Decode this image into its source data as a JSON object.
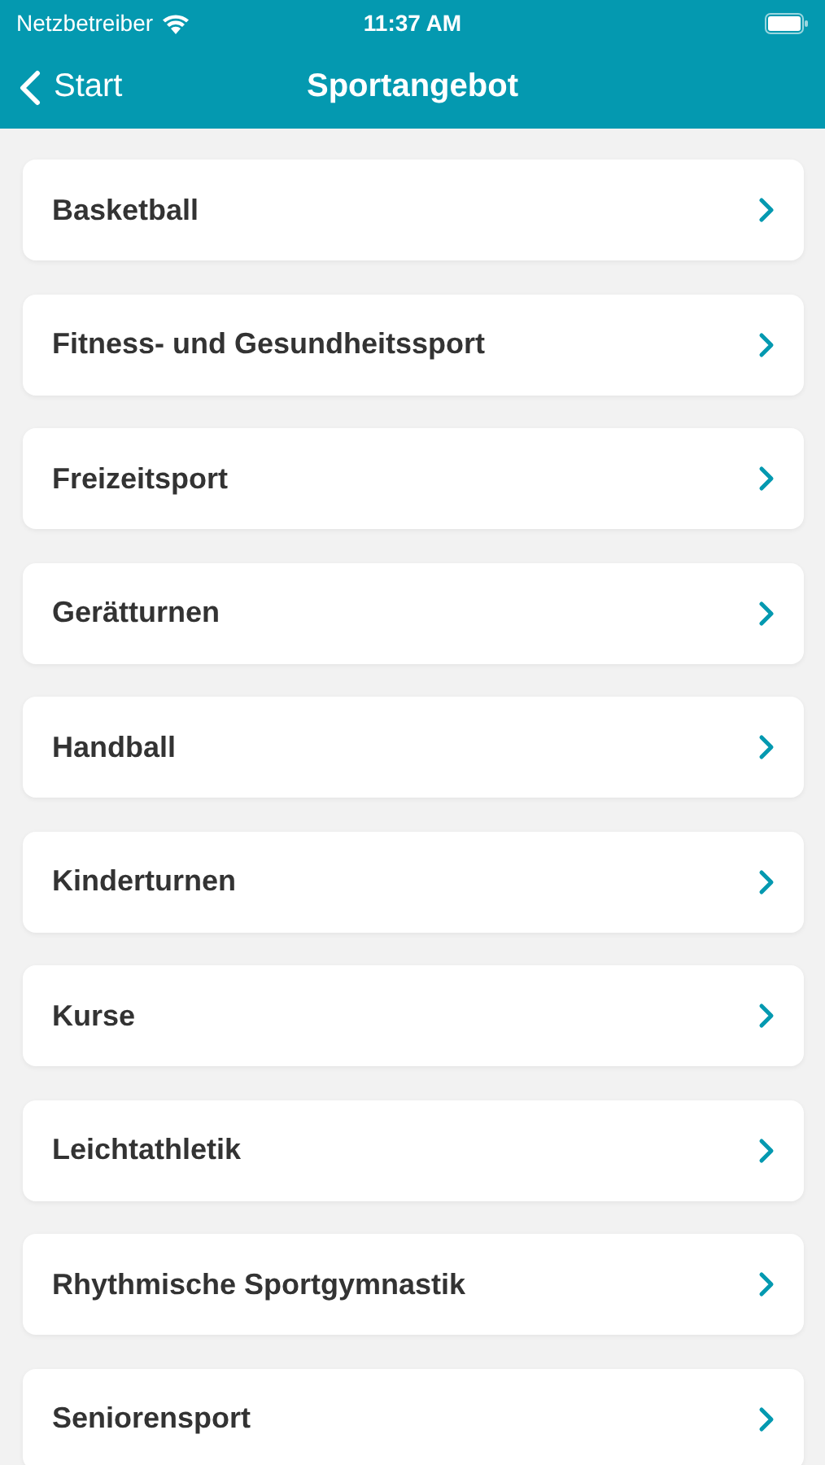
{
  "status_bar": {
    "carrier": "Netzbetreiber",
    "time": "11:37 AM"
  },
  "nav_bar": {
    "back_label": "Start",
    "title": "Sportangebot"
  },
  "items": [
    {
      "label": "Basketball"
    },
    {
      "label": "Fitness- und Gesundheitssport"
    },
    {
      "label": "Freizeitsport"
    },
    {
      "label": "Gerätturnen"
    },
    {
      "label": "Handball"
    },
    {
      "label": "Kinderturnen"
    },
    {
      "label": "Kurse"
    },
    {
      "label": "Leichtathletik"
    },
    {
      "label": "Rhythmische Sportgymnastik"
    },
    {
      "label": "Seniorensport"
    }
  ]
}
